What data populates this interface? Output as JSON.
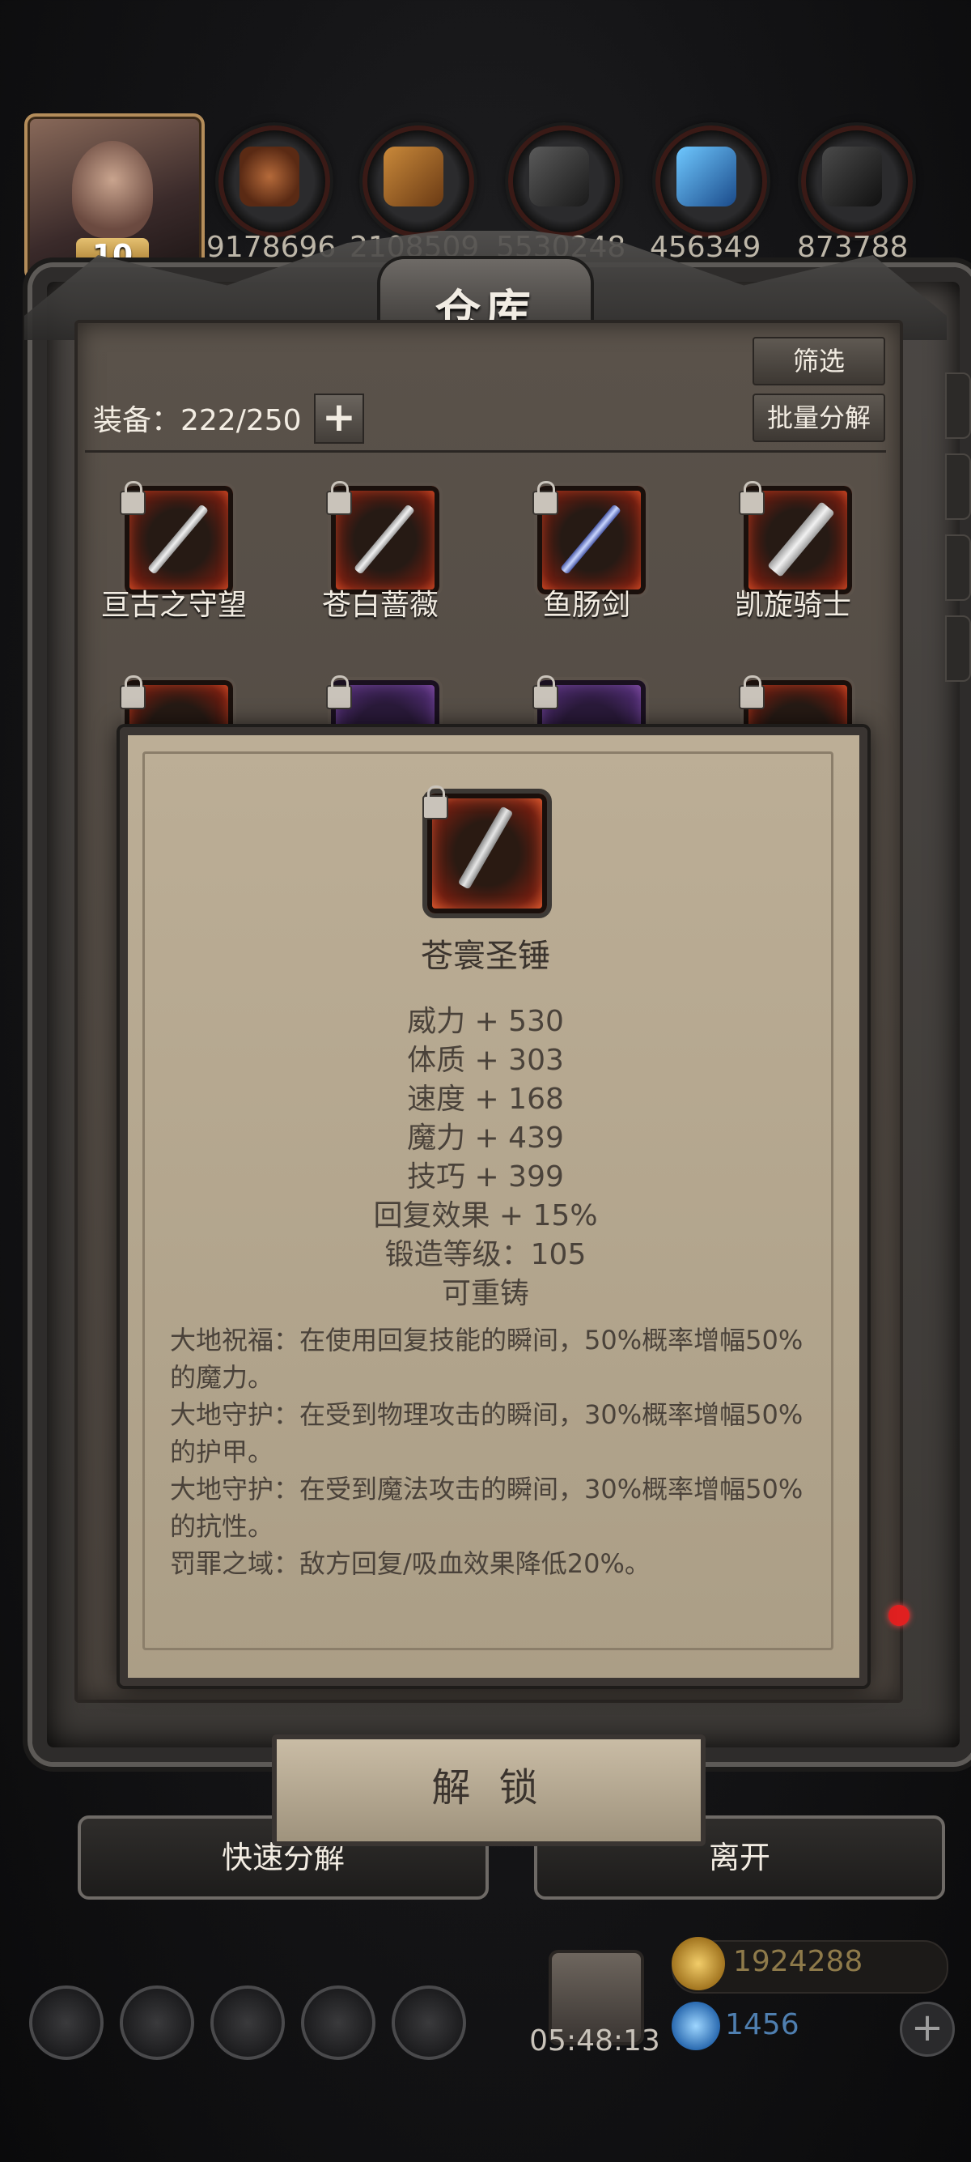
{
  "header": {
    "avatar_level": "10",
    "resources": [
      {
        "icon": "leather-icon",
        "value": "9178696"
      },
      {
        "icon": "wood-icon",
        "value": "2108509"
      },
      {
        "icon": "iron-icon",
        "value": "5530248"
      },
      {
        "icon": "crystal-icon",
        "value": "456349"
      },
      {
        "icon": "ore-icon",
        "value": "873788"
      }
    ]
  },
  "warehouse": {
    "title": "仓库",
    "filter_label": "筛选",
    "batch_decompose_label": "批量分解",
    "equip_label": "装备：222/250",
    "items": [
      {
        "name": "亘古之守望"
      },
      {
        "name": "苍白蔷薇"
      },
      {
        "name": "鱼肠剑"
      },
      {
        "name": "凯旋骑士"
      }
    ]
  },
  "popup": {
    "item_name": "苍寰圣锤",
    "stats": [
      "威力 + 530",
      "体质 + 303",
      "速度 + 168",
      "魔力 + 439",
      "技巧 + 399",
      "回复效果 + 15%",
      "锻造等级：105",
      "可重铸"
    ],
    "effects": [
      "大地祝福：在使用回复技能的瞬间，50%概率增幅50%的魔力。",
      "大地守护：在受到物理攻击的瞬间，30%概率增幅50%的护甲。",
      "大地守护：在受到魔法攻击的瞬间，30%概率增幅50%的抗性。",
      "罚罪之域：敌方回复/吸血效果降低20%。"
    ],
    "unlock_label": "解 锁"
  },
  "actions": {
    "quick_decompose_label": "快速分解",
    "leave_label": "离开"
  },
  "footer": {
    "timer": "05:48:13",
    "gold": "1924288",
    "gems": "1456"
  },
  "colors": {
    "accent_red": "#e02020",
    "panel": "#4a433d",
    "popup_bg": "#bcae96"
  }
}
